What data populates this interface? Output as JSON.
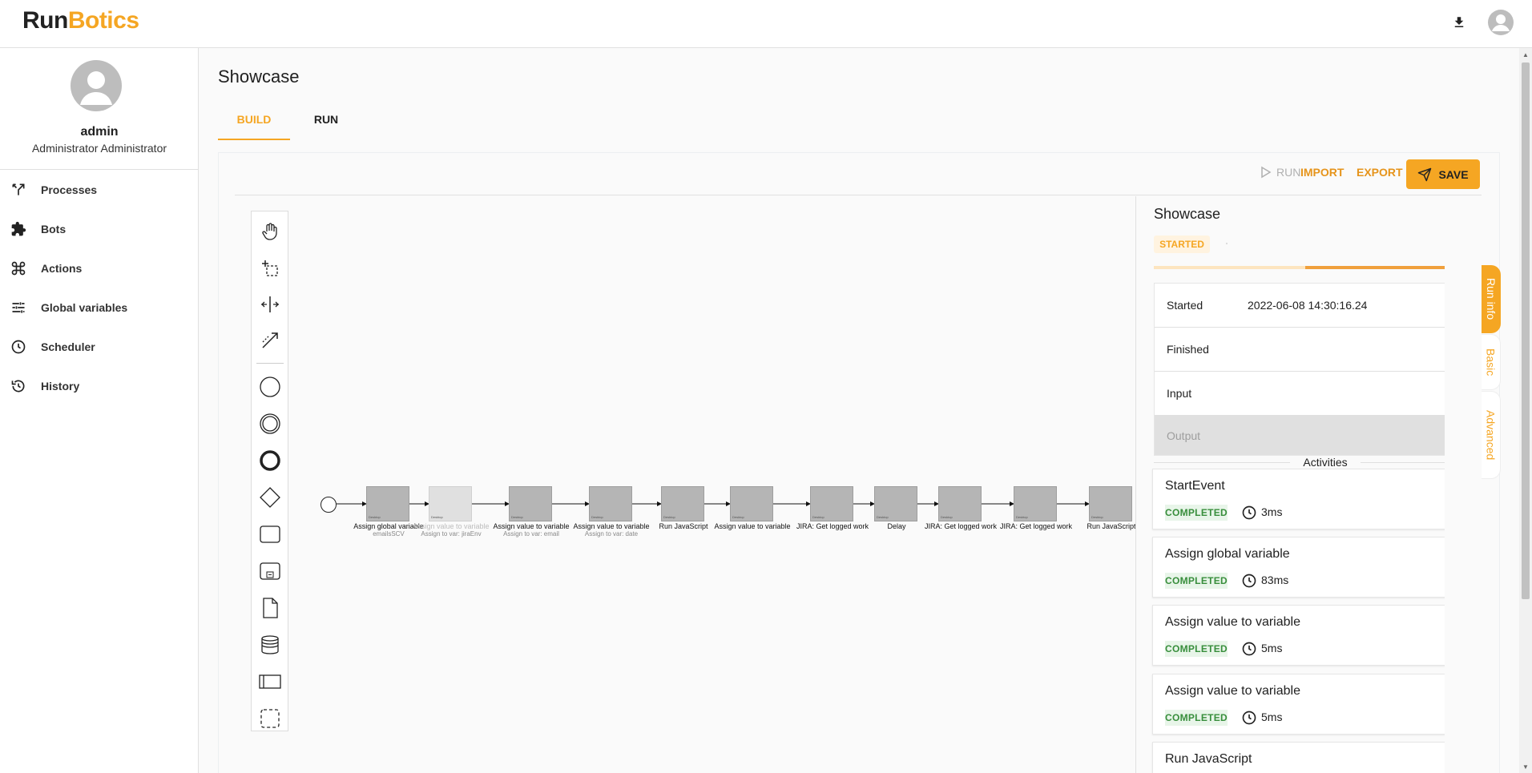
{
  "app": {
    "logo_part1": "Run",
    "logo_part2": "Botics"
  },
  "user": {
    "name": "admin",
    "role": "Administrator Administrator"
  },
  "sidebar": {
    "items": [
      {
        "label": "Processes",
        "icon": "processes-icon"
      },
      {
        "label": "Bots",
        "icon": "puzzle-icon"
      },
      {
        "label": "Actions",
        "icon": "command-icon"
      },
      {
        "label": "Global variables",
        "icon": "sliders-icon"
      },
      {
        "label": "Scheduler",
        "icon": "clock-icon"
      },
      {
        "label": "History",
        "icon": "history-icon"
      }
    ]
  },
  "page": {
    "title": "Showcase"
  },
  "tabs": [
    {
      "label": "BUILD",
      "active": true
    },
    {
      "label": "RUN",
      "active": false
    }
  ],
  "toolbar": {
    "run_label": "RUN",
    "import_label": "IMPORT",
    "export_label": "EXPORT",
    "save_label": "SAVE"
  },
  "diagram": {
    "tasks": [
      {
        "label": "Assign global variable",
        "sub": "emailsSCV",
        "tag": "Desktop"
      },
      {
        "label": "Assign value to variable",
        "sub": "Assign to var: jiraEnv",
        "tag": "Desktop"
      },
      {
        "label": "Assign value to variable",
        "sub": "Assign to var: email",
        "tag": "Desktop"
      },
      {
        "label": "Assign value to variable",
        "sub": "Assign to var: date",
        "tag": "Desktop"
      },
      {
        "label": "Run JavaScript",
        "sub": "",
        "tag": "Desktop"
      },
      {
        "label": "Assign value to variable",
        "sub": "",
        "tag": "Desktop"
      },
      {
        "label": "JIRA: Get logged work",
        "sub": "",
        "tag": "Desktop"
      },
      {
        "label": "Delay",
        "sub": "",
        "tag": "Desktop"
      },
      {
        "label": "JIRA: Get logged work",
        "sub": "",
        "tag": "Desktop"
      },
      {
        "label": "JIRA: Get logged work",
        "sub": "",
        "tag": "Desktop"
      },
      {
        "label": "Run JavaScript",
        "sub": "",
        "tag": "Desktop"
      }
    ]
  },
  "run_info": {
    "title": "Showcase",
    "status": "STARTED",
    "started_label": "Started",
    "started_value": "2022-06-08 14:30:16.24",
    "finished_label": "Finished",
    "finished_value": "",
    "input_label": "Input",
    "output_label": "Output",
    "activities_label": "Activities",
    "activities": [
      {
        "name": "StartEvent",
        "status": "COMPLETED",
        "time": "3ms"
      },
      {
        "name": "Assign global variable",
        "status": "COMPLETED",
        "time": "83ms"
      },
      {
        "name": "Assign value to variable",
        "status": "COMPLETED",
        "time": "5ms"
      },
      {
        "name": "Assign value to variable",
        "status": "COMPLETED",
        "time": "5ms"
      },
      {
        "name": "Run JavaScript",
        "status": "",
        "time": ""
      }
    ]
  },
  "side_tabs": [
    {
      "label": "Run info",
      "active": true
    },
    {
      "label": "Basic",
      "active": false
    },
    {
      "label": "Advanced",
      "active": false
    }
  ],
  "colors": {
    "accent": "#f5a623",
    "success": "#388e3c"
  }
}
